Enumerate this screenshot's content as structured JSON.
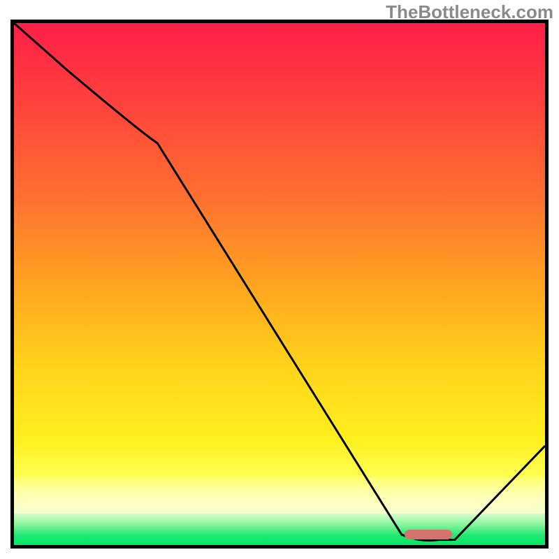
{
  "watermark": "TheBottleneck.com",
  "chart_data": {
    "type": "line",
    "title": "",
    "xlabel": "",
    "ylabel": "",
    "xlim": [
      0,
      100
    ],
    "ylim": [
      0,
      100
    ],
    "grid": false,
    "legend": false,
    "series": [
      {
        "name": "bottleneck-curve",
        "x": [
          0,
          10,
          27,
          73,
          80,
          83,
          100
        ],
        "y": [
          100,
          91,
          77,
          2,
          1,
          1,
          19
        ]
      }
    ],
    "marker": {
      "name": "optimal-range",
      "x_center": 78,
      "y": 2,
      "x_width": 9,
      "shape": "rounded-bar",
      "color": "#d4726e"
    },
    "background_bands": [
      {
        "name": "red-yellow-gradient",
        "y_from": 7,
        "y_to": 100
      },
      {
        "name": "pale-yellow",
        "y_from": 3,
        "y_to": 7
      },
      {
        "name": "green",
        "y_from": 0,
        "y_to": 3
      }
    ],
    "colors": {
      "gradient_top": "#ff1f48",
      "gradient_mid": "#ffd21a",
      "gradient_low": "#ffff55",
      "green": "#06e764",
      "curve": "#000000",
      "marker": "#d4726e",
      "frame": "#000000"
    }
  }
}
